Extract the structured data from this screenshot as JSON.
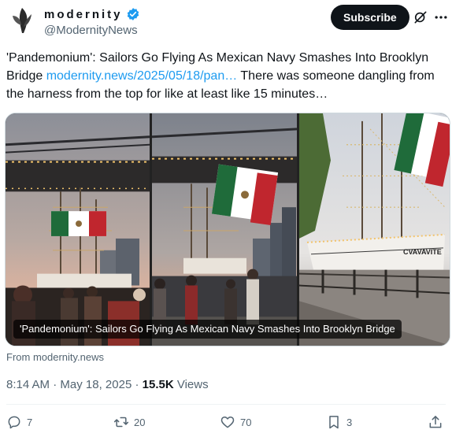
{
  "author": {
    "display_name": "modernity",
    "handle": "@ModernityNews",
    "verified": true,
    "avatar_icon": "modernity-logo-icon"
  },
  "header_actions": {
    "subscribe_label": "Subscribe",
    "grok_icon": "grok-icon",
    "more_icon": "more-icon"
  },
  "tweet": {
    "text_before_link": "'Pandemonium': Sailors Go Flying As Mexican Navy Smashes Into Brooklyn Bridge ",
    "link_text": "modernity.news/2025/05/18/pan…",
    "text_after_link": " There was someone dangling from the harness from the top for like at least like 15 minutes…"
  },
  "media": {
    "caption": "'Pandemonium': Sailors Go Flying As Mexican Navy Smashes Into Brooklyn Bridge",
    "ship_name": "CVAVAVITE"
  },
  "source": "From modernity.news",
  "meta": {
    "time": "8:14 AM",
    "separator1": " · ",
    "date": "May 18, 2025",
    "separator2": " · ",
    "views_count": "15.5K",
    "views_label": " Views"
  },
  "actions": {
    "replies": "7",
    "reposts": "20",
    "likes": "70",
    "bookmarks": "3"
  },
  "colors": {
    "link": "#1d9bf0",
    "verified": "#1d9bf0",
    "text": "#0f1419",
    "secondary": "#536471"
  }
}
